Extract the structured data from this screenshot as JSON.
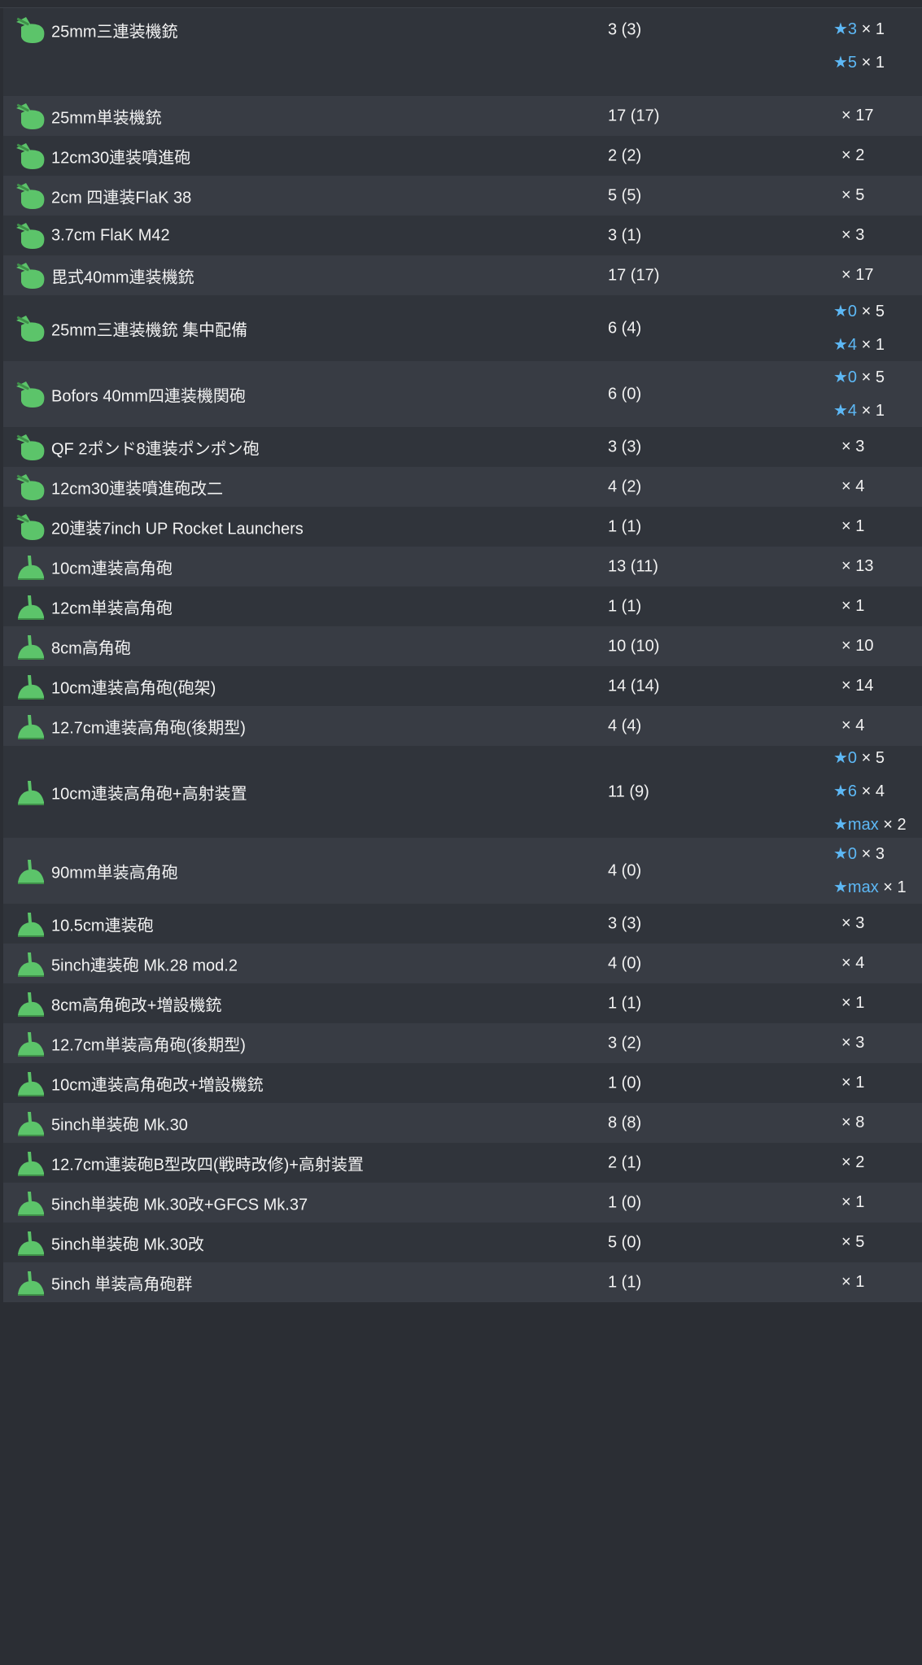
{
  "colors": {
    "row_odd": "#383c44",
    "row_even": "#30343b",
    "star": "#5db8f5",
    "icon_green": "#5cc46a"
  },
  "rows": [
    {
      "icon": "aa-gun-icon",
      "name": "25mm三連装機銃",
      "count": "3 (3)",
      "improvements": [
        {
          "star": "★3",
          "qty": "× 1"
        },
        {
          "star": "★5",
          "qty": "× 1"
        }
      ]
    },
    {
      "icon": "aa-gun-icon",
      "name": "25mm単装機銃",
      "count": "17 (17)",
      "improvements": [
        {
          "star": "",
          "qty": "× 17"
        }
      ]
    },
    {
      "icon": "aa-gun-icon",
      "name": "12cm30連装噴進砲",
      "count": "2 (2)",
      "improvements": [
        {
          "star": "",
          "qty": "× 2"
        }
      ]
    },
    {
      "icon": "aa-gun-icon",
      "name": "2cm 四連装FlaK 38",
      "count": "5 (5)",
      "improvements": [
        {
          "star": "",
          "qty": "× 5"
        }
      ]
    },
    {
      "icon": "aa-gun-icon",
      "name": "3.7cm FlaK M42",
      "count": "3 (1)",
      "improvements": [
        {
          "star": "",
          "qty": "× 3"
        }
      ]
    },
    {
      "icon": "aa-gun-icon",
      "name": "毘式40mm連装機銃",
      "count": "17 (17)",
      "improvements": [
        {
          "star": "",
          "qty": "× 17"
        }
      ]
    },
    {
      "icon": "aa-gun-icon",
      "name": "25mm三連装機銃 集中配備",
      "count": "6 (4)",
      "improvements": [
        {
          "star": "★0",
          "qty": "× 5"
        },
        {
          "star": "★4",
          "qty": "× 1"
        }
      ]
    },
    {
      "icon": "aa-gun-icon",
      "name": "Bofors 40mm四連装機関砲",
      "count": "6 (0)",
      "improvements": [
        {
          "star": "★0",
          "qty": "× 5"
        },
        {
          "star": "★4",
          "qty": "× 1"
        }
      ]
    },
    {
      "icon": "aa-gun-icon",
      "name": "QF 2ポンド8連装ポンポン砲",
      "count": "3 (3)",
      "improvements": [
        {
          "star": "",
          "qty": "× 3"
        }
      ]
    },
    {
      "icon": "aa-gun-icon",
      "name": "12cm30連装噴進砲改二",
      "count": "4 (2)",
      "improvements": [
        {
          "star": "",
          "qty": "× 4"
        }
      ]
    },
    {
      "icon": "aa-gun-icon",
      "name": "20連装7inch UP Rocket Launchers",
      "count": "1 (1)",
      "improvements": [
        {
          "star": "",
          "qty": "× 1"
        }
      ]
    },
    {
      "icon": "ha-gun-icon",
      "name": "10cm連装高角砲",
      "count": "13 (11)",
      "improvements": [
        {
          "star": "",
          "qty": "× 13"
        }
      ]
    },
    {
      "icon": "ha-gun-icon",
      "name": "12cm単装高角砲",
      "count": "1 (1)",
      "improvements": [
        {
          "star": "",
          "qty": "× 1"
        }
      ]
    },
    {
      "icon": "ha-gun-icon",
      "name": "8cm高角砲",
      "count": "10 (10)",
      "improvements": [
        {
          "star": "",
          "qty": "× 10"
        }
      ]
    },
    {
      "icon": "ha-gun-icon",
      "name": "10cm連装高角砲(砲架)",
      "count": "14 (14)",
      "improvements": [
        {
          "star": "",
          "qty": "× 14"
        }
      ]
    },
    {
      "icon": "ha-gun-icon",
      "name": "12.7cm連装高角砲(後期型)",
      "count": "4 (4)",
      "improvements": [
        {
          "star": "",
          "qty": "× 4"
        }
      ]
    },
    {
      "icon": "ha-gun-icon",
      "name": "10cm連装高角砲+高射装置",
      "count": "11 (9)",
      "improvements": [
        {
          "star": "★0",
          "qty": "× 5"
        },
        {
          "star": "★6",
          "qty": "× 4"
        },
        {
          "star": "★max",
          "qty": "× 2"
        }
      ]
    },
    {
      "icon": "ha-gun-icon",
      "name": "90mm単装高角砲",
      "count": "4 (0)",
      "improvements": [
        {
          "star": "★0",
          "qty": "× 3"
        },
        {
          "star": "★max",
          "qty": "× 1"
        }
      ]
    },
    {
      "icon": "ha-gun-icon",
      "name": "10.5cm連装砲",
      "count": "3 (3)",
      "improvements": [
        {
          "star": "",
          "qty": "× 3"
        }
      ]
    },
    {
      "icon": "ha-gun-icon",
      "name": "5inch連装砲 Mk.28 mod.2",
      "count": "4 (0)",
      "improvements": [
        {
          "star": "",
          "qty": "× 4"
        }
      ]
    },
    {
      "icon": "ha-gun-icon",
      "name": "8cm高角砲改+増設機銃",
      "count": "1 (1)",
      "improvements": [
        {
          "star": "",
          "qty": "× 1"
        }
      ]
    },
    {
      "icon": "ha-gun-icon",
      "name": "12.7cm単装高角砲(後期型)",
      "count": "3 (2)",
      "improvements": [
        {
          "star": "",
          "qty": "× 3"
        }
      ]
    },
    {
      "icon": "ha-gun-icon",
      "name": "10cm連装高角砲改+増設機銃",
      "count": "1 (0)",
      "improvements": [
        {
          "star": "",
          "qty": "× 1"
        }
      ]
    },
    {
      "icon": "ha-gun-icon",
      "name": "5inch単装砲 Mk.30",
      "count": "8 (8)",
      "improvements": [
        {
          "star": "",
          "qty": "× 8"
        }
      ]
    },
    {
      "icon": "ha-gun-icon",
      "name": "12.7cm連装砲B型改四(戦時改修)+高射装置",
      "count": "2 (1)",
      "improvements": [
        {
          "star": "",
          "qty": "× 2"
        }
      ]
    },
    {
      "icon": "ha-gun-icon",
      "name": "5inch単装砲 Mk.30改+GFCS Mk.37",
      "count": "1 (0)",
      "improvements": [
        {
          "star": "",
          "qty": "× 1"
        }
      ]
    },
    {
      "icon": "ha-gun-icon",
      "name": "5inch単装砲 Mk.30改",
      "count": "5 (0)",
      "improvements": [
        {
          "star": "",
          "qty": "× 5"
        }
      ]
    },
    {
      "icon": "ha-gun-icon",
      "name": "5inch 単装高角砲群",
      "count": "1 (1)",
      "improvements": [
        {
          "star": "",
          "qty": "× 1"
        }
      ]
    }
  ]
}
